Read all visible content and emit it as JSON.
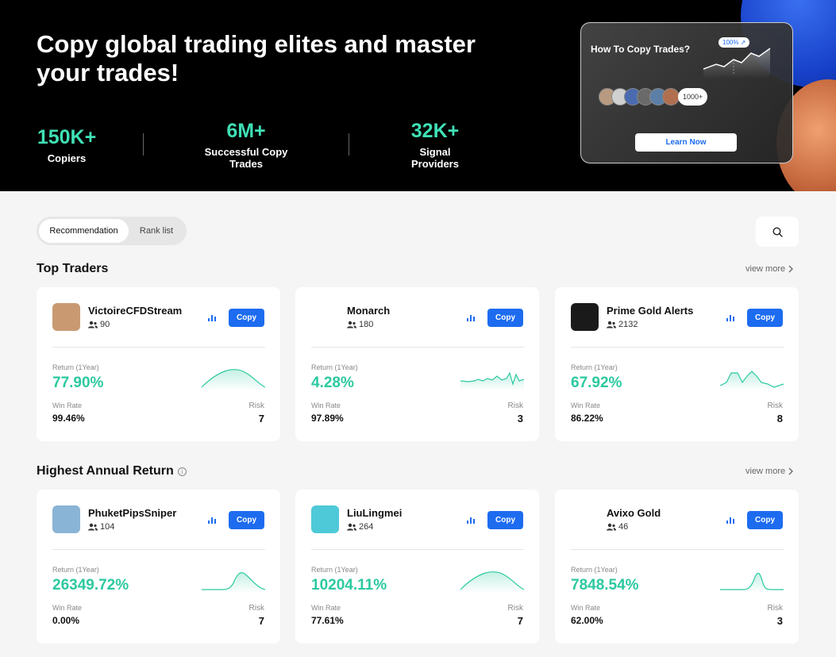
{
  "hero": {
    "title": "Copy global trading elites and master your trades!",
    "stats": [
      {
        "value": "150K+",
        "label": "Copiers"
      },
      {
        "value": "6M+",
        "label": "Successful Copy Trades"
      },
      {
        "value": "32K+",
        "label": "Signal Providers"
      }
    ],
    "promo": {
      "title": "How To Copy Trades?",
      "badge": "100% ↗",
      "avatar_count": "1000+",
      "button": "Learn Now"
    }
  },
  "tabs": [
    {
      "label": "Recommendation",
      "active": true
    },
    {
      "label": "Rank list",
      "active": false
    }
  ],
  "search_icon": "search-icon",
  "labels": {
    "return": "Return (1Year)",
    "win_rate": "Win Rate",
    "risk": "Risk",
    "copy": "Copy",
    "view_more": "view more"
  },
  "sections": [
    {
      "title": "Top Traders",
      "info": false,
      "cards": [
        {
          "name": "VictoireCFDStream",
          "followers": "90",
          "return": "77.90%",
          "win_rate": "99.46%",
          "risk": "7",
          "avatar_color": "#c99a72",
          "spark": "hill"
        },
        {
          "name": "Monarch",
          "followers": "180",
          "return": "4.28%",
          "win_rate": "97.89%",
          "risk": "3",
          "avatar_color": "#ffffff",
          "spark": "noisy"
        },
        {
          "name": "Prime Gold Alerts",
          "followers": "2132",
          "return": "67.92%",
          "win_rate": "86.22%",
          "risk": "8",
          "avatar_color": "#1a1a1a",
          "spark": "double"
        }
      ]
    },
    {
      "title": "Highest Annual Return",
      "info": true,
      "cards": [
        {
          "name": "PhuketPipsSniper",
          "followers": "104",
          "return": "26349.72%",
          "win_rate": "0.00%",
          "risk": "7",
          "avatar_color": "#8ab4d6",
          "spark": "rightpeak"
        },
        {
          "name": "LiuLingmei",
          "followers": "264",
          "return": "10204.11%",
          "win_rate": "77.61%",
          "risk": "7",
          "avatar_color": "#4ec9d8",
          "spark": "hill"
        },
        {
          "name": "Avixo Gold",
          "followers": "46",
          "return": "7848.54%",
          "win_rate": "62.00%",
          "risk": "3",
          "avatar_color": "#ffffff",
          "spark": "spike"
        }
      ]
    }
  ]
}
